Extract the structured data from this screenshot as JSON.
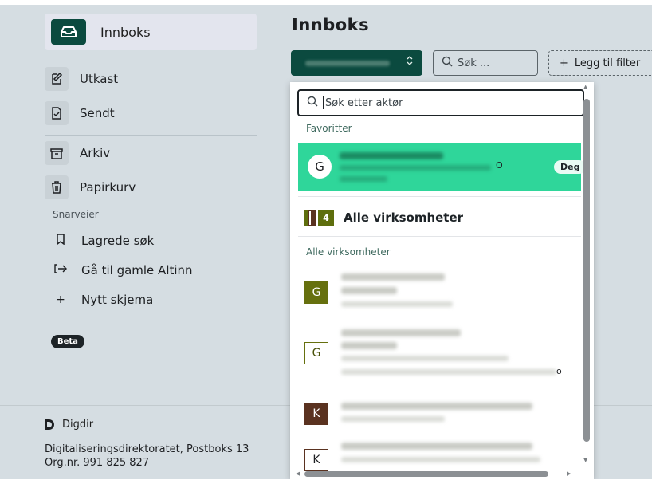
{
  "sidebar": {
    "active": "Innboks",
    "items": [
      "Utkast",
      "Sendt",
      "Arkiv",
      "Papirkurv"
    ],
    "shortcuts_heading": "Snarveier",
    "shortcuts": [
      {
        "icon": "bookmark-icon",
        "glyph": "⊓",
        "label": "Lagrede søk"
      },
      {
        "icon": "exit-icon",
        "glyph": "[→",
        "label": "Gå til gamle Altinn"
      },
      {
        "icon": "plus-icon",
        "glyph": "+",
        "label": "Nytt skjema"
      }
    ],
    "badge": "Beta"
  },
  "main": {
    "title": "Innboks",
    "search_placeholder": "Søk ...",
    "filter_label": "Legg til filter"
  },
  "dropdown": {
    "search_placeholder": "Søk etter aktør",
    "favorites_heading": "Favoritter",
    "favorite": {
      "initial": "G",
      "suffix": "O",
      "badge": "Deg"
    },
    "all_label": "Alle virksomheter",
    "all_count": "4",
    "section_heading": "Alle virksomheter",
    "rows": [
      {
        "initial": "G",
        "suffix": ""
      },
      {
        "initial": "G",
        "suffix": "o"
      },
      {
        "initial": "K",
        "suffix": ""
      },
      {
        "initial": "K",
        "suffix": ""
      }
    ]
  },
  "footer": {
    "brand": "Digdir",
    "address": "Digitaliseringsdirektoratet, Postboks 13",
    "orgnr": "Org.nr. 991 825 827"
  },
  "colors": {
    "accent": "#0b4a3f",
    "favorite_highlight": "#2fd69a",
    "olive": "#66700e",
    "brown": "#5a3220",
    "background": "#d5dde2"
  }
}
